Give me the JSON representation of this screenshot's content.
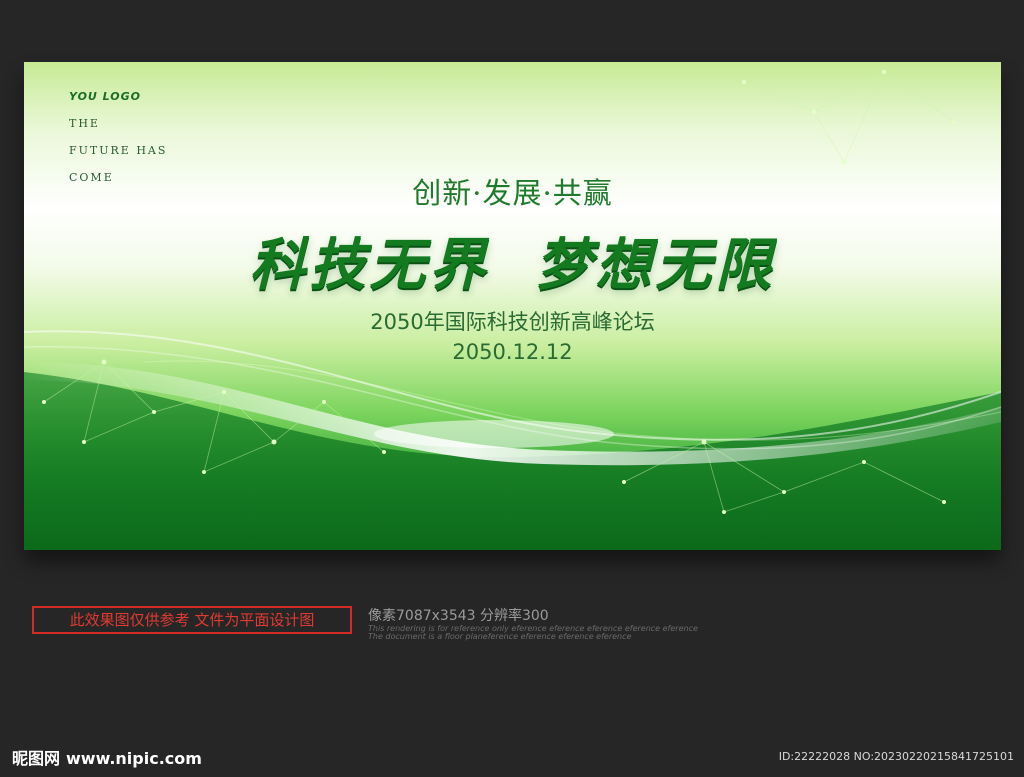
{
  "banner": {
    "logo": "YOU LOGO",
    "tagline": [
      "THE",
      "FUTURE HAS",
      "COME"
    ],
    "slogan_small": "创新·发展·共赢",
    "headline_left": "科技无界",
    "headline_right": "梦想无限",
    "forum_title": "2050年国际科技创新高峰论坛",
    "date": "2050.12.12",
    "colors": {
      "primary_green": "#137a20",
      "text_green": "#2a6a33"
    }
  },
  "notice": {
    "label": "此效果图仅供参考 文件为平面设计图",
    "pixel_info": "像素7087x3543  分辨率300",
    "reference_line_1": "This rendering is for reference only  eference eference eference eference eference",
    "reference_line_2": "The document is a floor planeference eference eference eference"
  },
  "footer": {
    "site_name": "昵图网",
    "site_url": "www.nipic.com",
    "image_id": "ID:22222028 NO:20230220215841725101"
  }
}
